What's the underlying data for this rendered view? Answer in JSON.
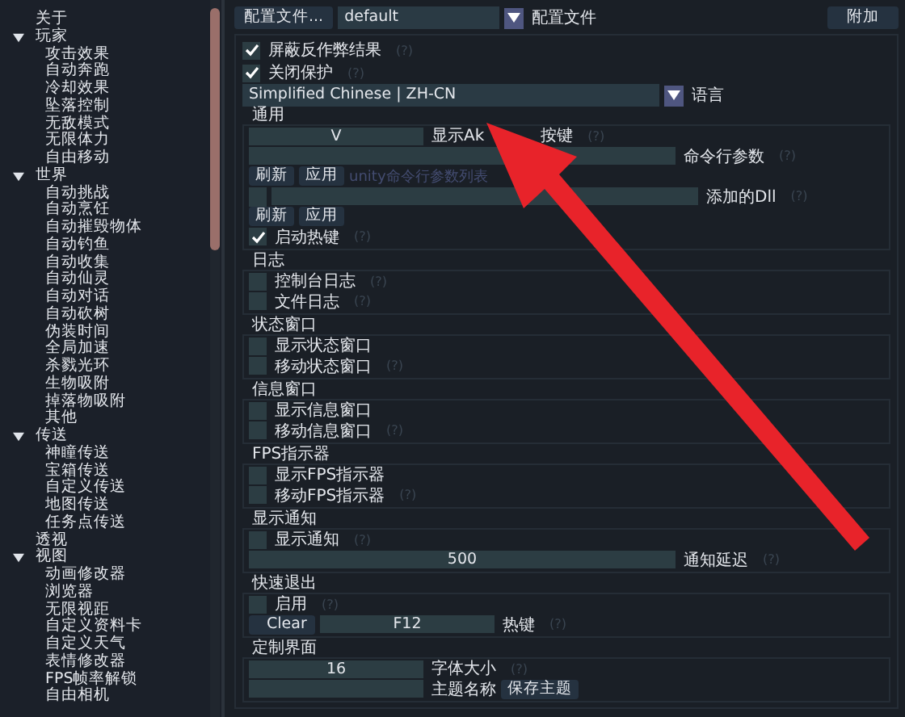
{
  "sidebar": {
    "items": [
      {
        "label": "关于"
      },
      {
        "label": "玩家",
        "expanded": true,
        "children": [
          {
            "label": "攻击效果"
          },
          {
            "label": "自动奔跑"
          },
          {
            "label": "冷却效果"
          },
          {
            "label": "坠落控制"
          },
          {
            "label": "无敌模式"
          },
          {
            "label": "无限体力"
          },
          {
            "label": "自由移动"
          }
        ]
      },
      {
        "label": "世界",
        "expanded": true,
        "children": [
          {
            "label": "自动挑战"
          },
          {
            "label": "自动烹饪"
          },
          {
            "label": "自动摧毁物体"
          },
          {
            "label": "自动钓鱼"
          },
          {
            "label": "自动收集"
          },
          {
            "label": "自动仙灵"
          },
          {
            "label": "自动对话"
          },
          {
            "label": "自动砍树"
          },
          {
            "label": "伪装时间"
          },
          {
            "label": "全局加速"
          },
          {
            "label": "杀戮光环"
          },
          {
            "label": "生物吸附"
          },
          {
            "label": "掉落物吸附"
          },
          {
            "label": "其他"
          }
        ]
      },
      {
        "label": "传送",
        "expanded": true,
        "children": [
          {
            "label": "神瞳传送"
          },
          {
            "label": "宝箱传送"
          },
          {
            "label": "自定义传送"
          },
          {
            "label": "地图传送"
          },
          {
            "label": "任务点传送"
          }
        ]
      },
      {
        "label": "透视"
      },
      {
        "label": "视图",
        "expanded": true,
        "children": [
          {
            "label": "动画修改器"
          },
          {
            "label": "浏览器"
          },
          {
            "label": "无限视距"
          },
          {
            "label": "自定义资料卡"
          },
          {
            "label": "自定义天气"
          },
          {
            "label": "表情修改器"
          },
          {
            "label": "FPS帧率解锁"
          },
          {
            "label": "自由相机"
          }
        ]
      }
    ]
  },
  "profile": {
    "button": "配置文件...",
    "value": "default",
    "label": "配置文件",
    "attach_button": "附加"
  },
  "options": [
    {
      "label": "屏蔽反作弊结果",
      "checked": true,
      "hint": "(?)"
    },
    {
      "label": "关闭保护",
      "checked": true,
      "hint": "(?)"
    }
  ],
  "language": {
    "value": "Simplified Chinese | ZH-CN",
    "label": "语言"
  },
  "sections": [
    {
      "title": "通用",
      "rows": [
        {
          "kind": "short_field",
          "value": "V",
          "label": "显示Ak",
          "label_tail": "按键",
          "hint": "(?)"
        },
        {
          "kind": "wide_field",
          "label": "命令行参数",
          "hint": "(?)"
        },
        {
          "kind": "buttons",
          "buttons": [
            "刷新",
            "应用"
          ],
          "note": "unity命令行参数列表"
        },
        {
          "kind": "dll_field",
          "label": "添加的Dll",
          "hint": "(?)"
        },
        {
          "kind": "buttons",
          "buttons": [
            "刷新",
            "应用"
          ]
        },
        {
          "kind": "checkbox",
          "label": "启动热键",
          "checked": true,
          "hint": "(?)"
        }
      ]
    },
    {
      "title": "日志",
      "rows": [
        {
          "kind": "checkbox",
          "label": "控制台日志",
          "checked": false,
          "hint": "(?)"
        },
        {
          "kind": "checkbox",
          "label": "文件日志",
          "checked": false,
          "hint": "(?)"
        }
      ]
    },
    {
      "title": "状态窗口",
      "rows": [
        {
          "kind": "checkbox",
          "label": "显示状态窗口",
          "checked": false
        },
        {
          "kind": "checkbox",
          "label": "移动状态窗口",
          "checked": false,
          "hint": "(?)"
        }
      ]
    },
    {
      "title": "信息窗口",
      "rows": [
        {
          "kind": "checkbox",
          "label": "显示信息窗口",
          "checked": false
        },
        {
          "kind": "checkbox",
          "label": "移动信息窗口",
          "checked": false,
          "hint": "(?)"
        }
      ]
    },
    {
      "title": "FPS指示器",
      "rows": [
        {
          "kind": "checkbox",
          "label": "显示FPS指示器",
          "checked": false
        },
        {
          "kind": "checkbox",
          "label": "移动FPS指示器",
          "checked": false,
          "hint": "(?)"
        }
      ]
    },
    {
      "title": "显示通知",
      "rows": [
        {
          "kind": "checkbox",
          "label": "显示通知",
          "checked": false,
          "hint": "(?)"
        },
        {
          "kind": "wide_field",
          "value": "500",
          "label": "通知延迟",
          "hint": "(?)"
        }
      ]
    },
    {
      "title": "快速退出",
      "rows": [
        {
          "kind": "checkbox",
          "label": "启用",
          "checked": false,
          "hint": "(?)"
        },
        {
          "kind": "hotkey",
          "button": "Clear",
          "value": "F12",
          "label": "热键",
          "hint": "(?)"
        }
      ]
    },
    {
      "title": "定制界面",
      "rows": [
        {
          "kind": "short_field",
          "value": "16",
          "label": "字体大小",
          "hint": "(?)"
        },
        {
          "kind": "short_field",
          "label": "主题名称",
          "button": "保存主题"
        }
      ]
    }
  ]
}
